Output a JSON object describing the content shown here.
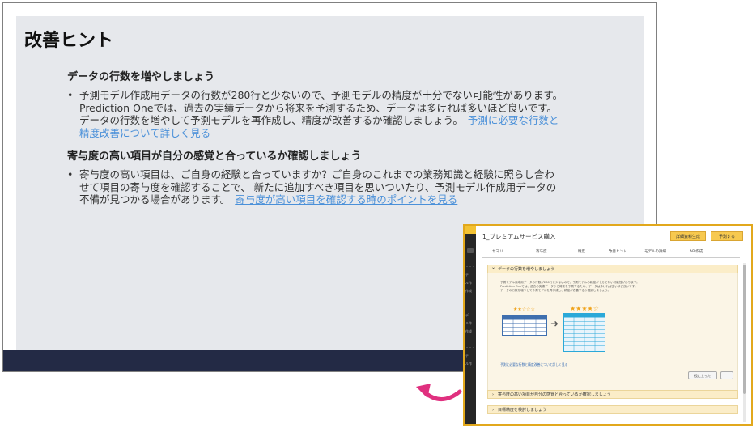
{
  "main": {
    "title": "改善ヒント",
    "sections": [
      {
        "heading": "データの行数を増やしましょう",
        "lines": [
          "予測モデル作成用データの行数が280行と少ないので、予測モデルの精度が十分でない可能性があります。",
          "Prediction Oneでは、過去の実績データから将来を予測するため、データは多ければ多いほど良いです。",
          "データの行数を増やして予測モデルを再作成し、精度が改善するか確認しましょう。"
        ],
        "link_line1": "予測に必要な行数と",
        "link_line2": "精度改善について詳しく見る"
      },
      {
        "heading": "寄与度の高い項目が自分の感覚と合っているか確認しましょう",
        "lines": [
          "寄与度の高い項目は、ご自身の経験と合っていますか？ご自身のこれまでの業務知識と経験に照らし合わ",
          "せて項目の寄与度を確認することで、 新たに追加すべき項目を思いついたり、予測モデル作成用データの",
          "不備が見つかる場合があります。"
        ],
        "link": "寄与度が高い項目を確認する時のポイントを見る"
      }
    ]
  },
  "inset": {
    "title": "1_プレミアムサービス購入",
    "buttons": [
      "詳細資料生成",
      "予測する"
    ],
    "tabs": [
      "サマリ",
      "寄与度",
      "精度",
      "改善ヒント",
      "モデルの詳細",
      "API作成"
    ],
    "active_tab": "改善ヒント",
    "accordion_open": "データの行数を増やしましょう",
    "body_lines": [
      "予測モデル作成用データの行数が280行と少ないので、予測モデルの精度が十分でない可能性があります。",
      "Prediction Oneでは、過去の実績データから将来を予測するため、データは多ければ多いほど良いです。",
      "データの行数を増やして予測モデルを再作成し、精度が改善するか確認しましょう。"
    ],
    "stars_before": "★★☆☆☆",
    "stars_after": "★★★★☆",
    "link": "予測に必要な行数と精度改善について詳しく見る",
    "feedback_buttons": [
      "役に立った",
      ""
    ],
    "accordions": [
      "寄与度の高い項目が自分の感覚と合っているか確認しましょう",
      "目標精度を検討しましょう"
    ],
    "sidebar_labels": [
      "・・・",
      "デ",
      "ル作",
      "作成",
      "・・・",
      "デ",
      "ル作",
      "作成",
      "・・・",
      "デ",
      "ル作"
    ]
  },
  "colors": {
    "accent": "#e2a81c",
    "link": "#4a90d9",
    "arrow": "#e0307f",
    "footer": "#232a45"
  }
}
